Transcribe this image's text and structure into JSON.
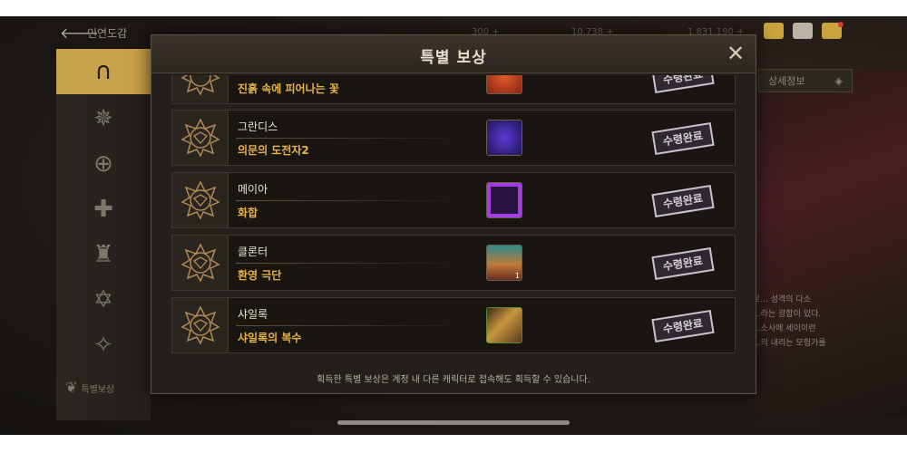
{
  "topbar": {
    "back_label": "인연도감",
    "resources": [
      "300 +",
      "10,738 +",
      "1,831,190 +"
    ]
  },
  "sidebar": {
    "special_label": "특별보상"
  },
  "background": {
    "detail_tab": "상세정보",
    "description_lines": [
      "로... 성격의 다소",
      "...라는 광합이 있다.",
      "...소사에 세이이런",
      "...의 내리는 모험가를"
    ]
  },
  "modal": {
    "title": "특별 보상",
    "footer_note": "획득한 특별 보상은 계정 내 다른 캐릭터로 접속해도 획득할 수 있습니다.",
    "stamp_label": "수령완료",
    "rows": [
      {
        "name": "",
        "subtitle": "진흙 속에 피어나는 꽃",
        "icon": "red-flower-frame-icon",
        "badge": ""
      },
      {
        "name": "그란디스",
        "subtitle": "의문의 도전자2",
        "icon": "purple-crystal-icon",
        "badge": ""
      },
      {
        "name": "메이아",
        "subtitle": "화합",
        "icon": "purple-frame-icon",
        "badge": ""
      },
      {
        "name": "클론터",
        "subtitle": "환영 극단",
        "icon": "clown-portrait-icon",
        "badge": "1"
      },
      {
        "name": "샤일록",
        "subtitle": "샤일록의 복수",
        "icon": "golden-spear-icon",
        "badge": ""
      }
    ]
  }
}
